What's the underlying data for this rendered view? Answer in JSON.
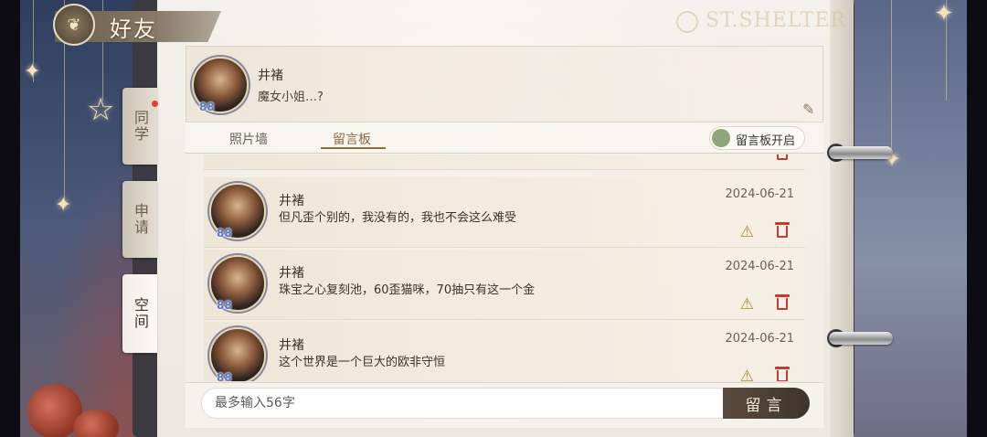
{
  "header": {
    "title": "好友",
    "brand": "ST.SHELTER"
  },
  "side_tabs": [
    {
      "label": "同学",
      "has_notification": true
    },
    {
      "label": "申请",
      "has_notification": false
    },
    {
      "label": "空间",
      "has_notification": false,
      "active": true
    }
  ],
  "profile": {
    "name": "井褚",
    "signature": "魔女小姐…?",
    "level": "88"
  },
  "sub_tabs": [
    {
      "label": "照片墙",
      "active": false
    },
    {
      "label": "留言板",
      "active": true
    }
  ],
  "board_toggle": {
    "label": "留言板开启",
    "on": true,
    "color": "#8ea679"
  },
  "messages": [
    {
      "name": "井褚",
      "level": "88",
      "text": "但凡歪个别的，我没有的，我也不会这么难受",
      "date": "2024-06-21"
    },
    {
      "name": "井褚",
      "level": "88",
      "text": "珠宝之心复刻池，60歪猫咪，70抽只有这一个金",
      "date": "2024-06-21"
    },
    {
      "name": "井褚",
      "level": "88",
      "text": "这个世界是一个巨大的欧非守恒",
      "date": "2024-06-21"
    }
  ],
  "composer": {
    "placeholder": "最多输入56字",
    "send_label": "留言"
  },
  "icons": {
    "report": "warning-icon",
    "delete": "trash-icon",
    "edit": "edit-icon"
  },
  "colors": {
    "accent": "#8a6e3e",
    "delete": "#c23a30",
    "send_button": "#4a3d33"
  }
}
